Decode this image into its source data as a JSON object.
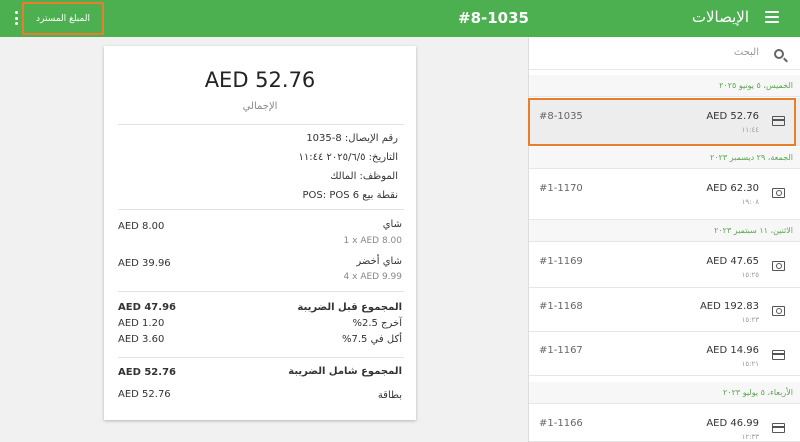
{
  "header": {
    "title": "الإيصالات",
    "receipt_title": "#8-1035",
    "refund_label": "المبلغ المسترد"
  },
  "receipt": {
    "total_amount": "AED 52.76",
    "total_label": "الإجمالي",
    "meta": [
      "رقم الإيصال: 8-1035",
      "التاريخ: ٢٠٢٥/٦/٥ ١١:٤٤",
      "الموظف: المالك",
      "نقطة بيع POS: POS 6"
    ],
    "lines": [
      {
        "name": "شاي",
        "detail": "1 x AED 8.00",
        "amount": "AED 8.00"
      },
      {
        "name": "شاي أخضر",
        "detail": "4 x AED 9.99",
        "amount": "AED 39.96"
      }
    ],
    "subtotal_label": "المجموع قبل الضريبة",
    "subtotal": "AED 47.96",
    "taxes": [
      {
        "label": "آخرج 2.5%",
        "amount": "AED 1.20"
      },
      {
        "label": "أكل في 7.5%",
        "amount": "AED 3.60"
      }
    ],
    "grand_total_label": "المجموع شامل الضريبة",
    "grand_total": "AED 52.76",
    "payment_label": "بطاقة",
    "payment_amount": "AED 52.76"
  },
  "sidebar": {
    "search_placeholder": "البحث",
    "groups": [
      {
        "date": "الخميس، ٥ يونيو ٢٠٢٥",
        "items": [
          {
            "id": "#8-1035",
            "amount": "AED 52.76",
            "time": "١١:٤٤",
            "icon": "card-icon",
            "selected": true
          }
        ]
      },
      {
        "date": "الجمعة، ٢٩ ديسمبر ٢٠٢٣",
        "items": [
          {
            "id": "#1-1170",
            "amount": "AED 62.30",
            "time": "١٩:٠٨",
            "icon": "cash-icon"
          }
        ]
      },
      {
        "date": "الاثنين، ١١ سبتمبر ٢٠٢٣",
        "items": [
          {
            "id": "#1-1169",
            "amount": "AED 47.65",
            "time": "١٥:٢٥",
            "icon": "cash-icon"
          },
          {
            "id": "#1-1168",
            "amount": "AED 192.83",
            "time": "١٥:٢٣",
            "icon": "cash-icon"
          },
          {
            "id": "#1-1167",
            "amount": "AED 14.96",
            "time": "١٥:٢١",
            "icon": "card-icon"
          }
        ]
      },
      {
        "date": "الأربعاء، ٥ يوليو ٢٠٢٣",
        "items": [
          {
            "id": "#1-1166",
            "amount": "AED 46.99",
            "time": "١٢:٣٣",
            "icon": "card-icon"
          }
        ]
      }
    ]
  },
  "colors": {
    "accent": "#4caf50",
    "highlight": "#e87d2e",
    "date_header_text": "#5aa74e"
  }
}
